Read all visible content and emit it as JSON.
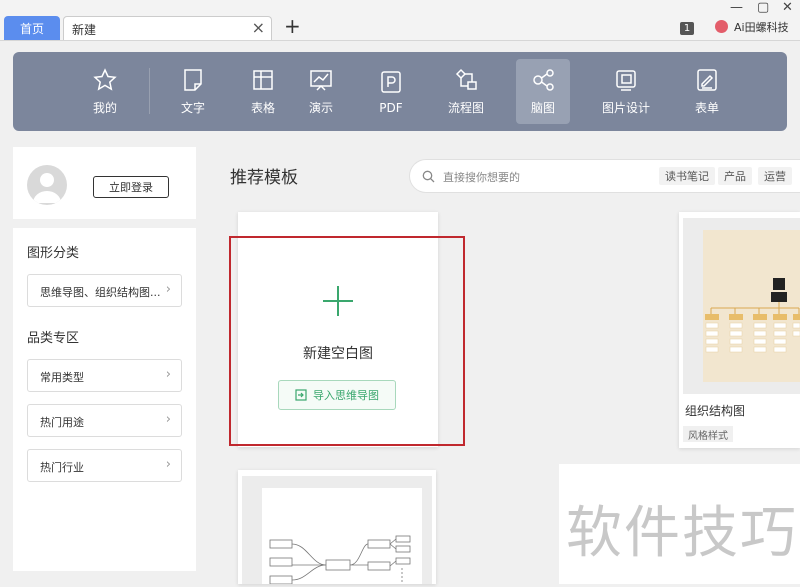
{
  "tabs": {
    "home": "首页",
    "current": "新建",
    "close": "×",
    "add": "+"
  },
  "window": {
    "minimize": "—",
    "maximize": "▢",
    "close": "✕",
    "badge": "1"
  },
  "user": {
    "name": "Ai田螺科技"
  },
  "toolbar": {
    "items": [
      {
        "label": "我的",
        "icon": "star-icon"
      },
      {
        "label": "文字",
        "icon": "document-icon"
      },
      {
        "label": "表格",
        "icon": "table-icon"
      },
      {
        "label": "演示",
        "icon": "presentation-icon"
      },
      {
        "label": "PDF",
        "icon": "pdf-icon"
      },
      {
        "label": "流程图",
        "icon": "flowchart-icon"
      },
      {
        "label": "脑图",
        "icon": "mindmap-icon"
      },
      {
        "label": "图片设计",
        "icon": "image-design-icon"
      },
      {
        "label": "表单",
        "icon": "form-icon"
      }
    ],
    "active": "脑图"
  },
  "sidebar": {
    "login": "立即登录",
    "shape_heading": "图形分类",
    "shape_item": "思维导图、组织结构图...",
    "category_heading": "品类专区",
    "items": [
      "常用类型",
      "热门用途",
      "热门行业"
    ],
    "chevron": "›"
  },
  "main": {
    "title": "推荐模板",
    "search_placeholder": "直接搜你想要的",
    "search_tags": [
      "读书笔记",
      "产品",
      "运营"
    ],
    "blank_card": {
      "label": "新建空白图",
      "import": "导入思维导图"
    },
    "org_card": {
      "name": "组织结构图",
      "tag": "风格样式"
    }
  },
  "watermark": "软件技巧"
}
